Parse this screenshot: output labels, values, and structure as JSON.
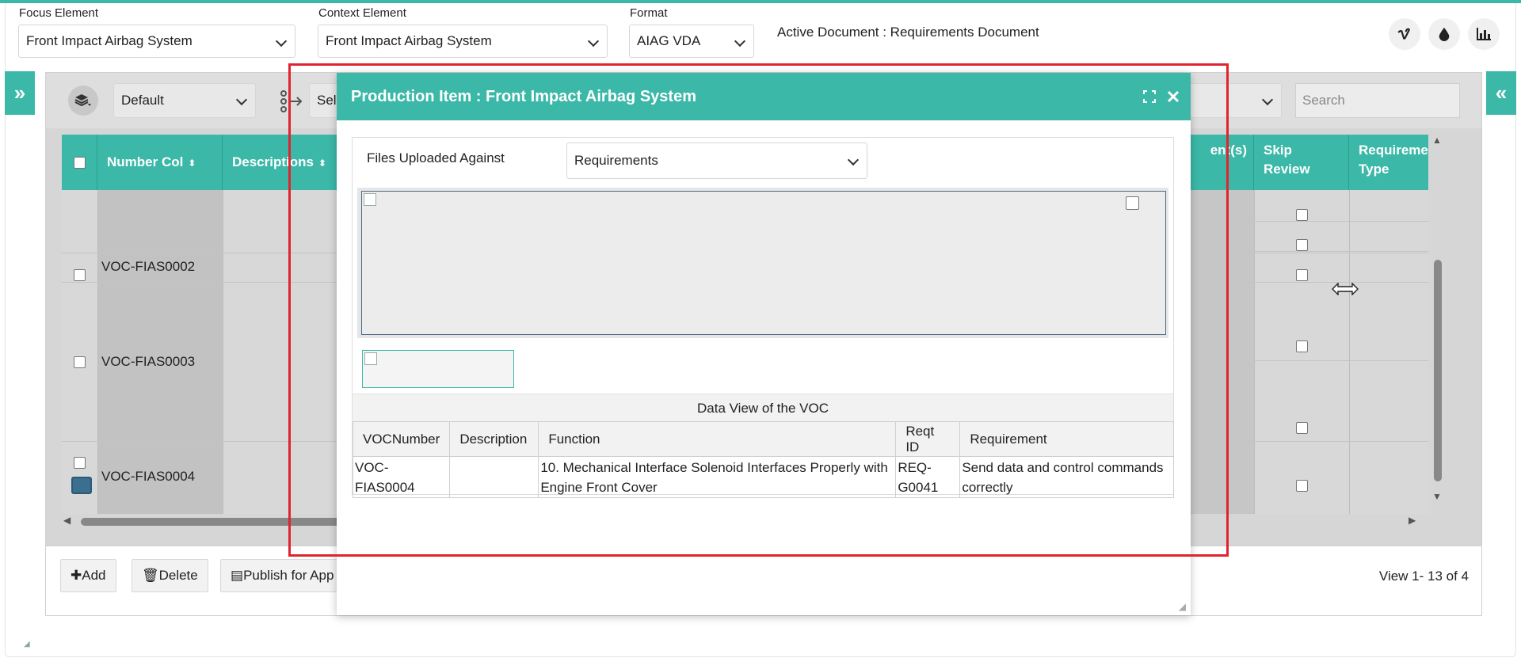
{
  "header": {
    "focus_label": "Focus Element",
    "focus_value": "Front Impact Airbag System",
    "context_label": "Context Element",
    "context_value": "Front Impact Airbag System",
    "format_label": "Format",
    "format_value": "AIAG VDA",
    "active_document": "Active Document : Requirements Document",
    "action_icons": [
      "vimeo-icon",
      "drop-icon",
      "bar-chart-icon"
    ]
  },
  "toolbar": {
    "view_select": "Default",
    "second_select_partial": "Sel",
    "search_placeholder": "Search"
  },
  "grid": {
    "columns": [
      "Number Col",
      "Descriptions",
      "ent(s)",
      "Skip Review",
      "Requireme Type"
    ],
    "rows": [
      {
        "number": "VOC-FIAS0002"
      },
      {
        "number": "VOC-FIAS0003"
      },
      {
        "number": "VOC-FIAS0004"
      }
    ],
    "footer": {
      "add": "Add",
      "delete": "Delete",
      "publish": "Publish for App",
      "view_count": "View 1- 13 of 4"
    }
  },
  "modal": {
    "title": "Production Item : Front Impact Airbag System",
    "files_label": "Files Uploaded Against",
    "files_select": "Requirements",
    "data_view_title": "Data View of the VOC",
    "table": {
      "headers": [
        "VOCNumber",
        "Description",
        "Function",
        "Reqt ID",
        "Requirement"
      ],
      "rows": [
        {
          "voc_number": "VOC-FIAS0004",
          "description": "",
          "function": "10. Mechanical Interface Solenoid Interfaces Properly with Engine Front Cover",
          "reqt_id": "REQ-G0041",
          "requirement": "Send data and control commands correctly"
        }
      ]
    }
  },
  "colors": {
    "accent": "#3bb8a8",
    "highlight": "#e0242f"
  }
}
